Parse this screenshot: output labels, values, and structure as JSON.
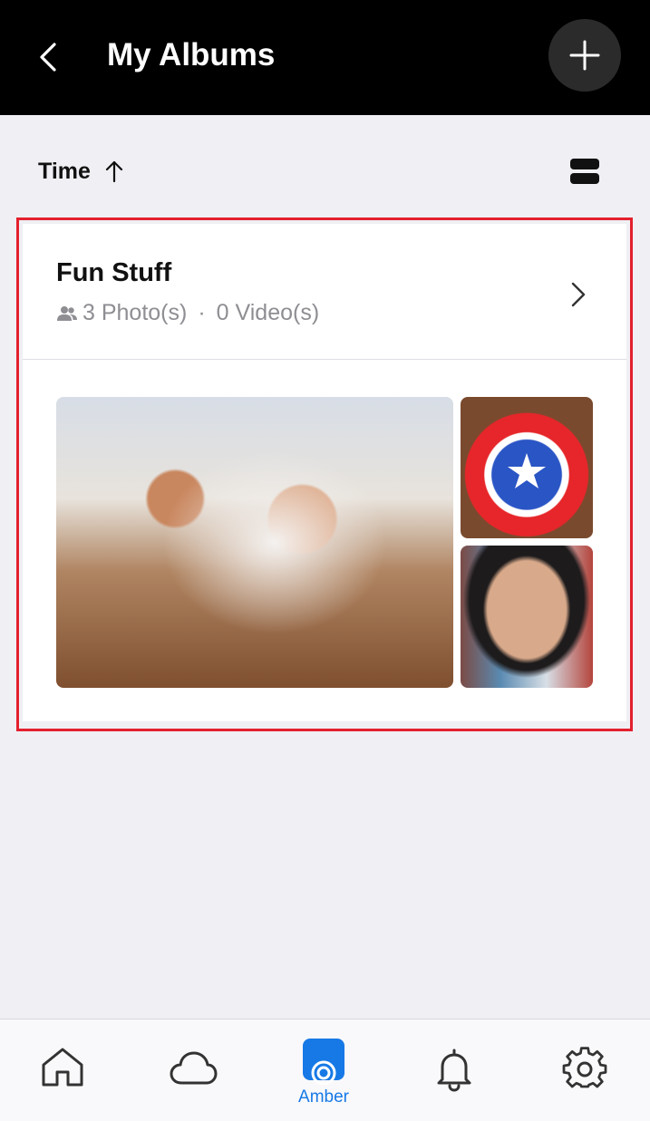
{
  "header": {
    "title": "My Albums",
    "back_icon": "chevron-left-icon",
    "add_icon": "plus-icon"
  },
  "sort": {
    "label": "Time",
    "direction_icon": "arrow-up-icon",
    "view_toggle_icon": "list-view-icon"
  },
  "album": {
    "name": "Fun Stuff",
    "photos": "3 Photo(s)",
    "separator": "·",
    "videos": "0 Video(s)",
    "people_icon": "people-icon",
    "open_icon": "chevron-right-icon"
  },
  "tabbar": {
    "items": [
      {
        "icon": "home-icon",
        "label": ""
      },
      {
        "icon": "cloud-icon",
        "label": ""
      },
      {
        "icon": "amber-icon",
        "label": "Amber",
        "active": true
      },
      {
        "icon": "bell-icon",
        "label": ""
      },
      {
        "icon": "gear-icon",
        "label": ""
      }
    ]
  },
  "colors": {
    "header_bg": "#000000",
    "highlight_border": "#e4202d",
    "accent": "#1779e6",
    "page_bg": "#efeff4"
  }
}
